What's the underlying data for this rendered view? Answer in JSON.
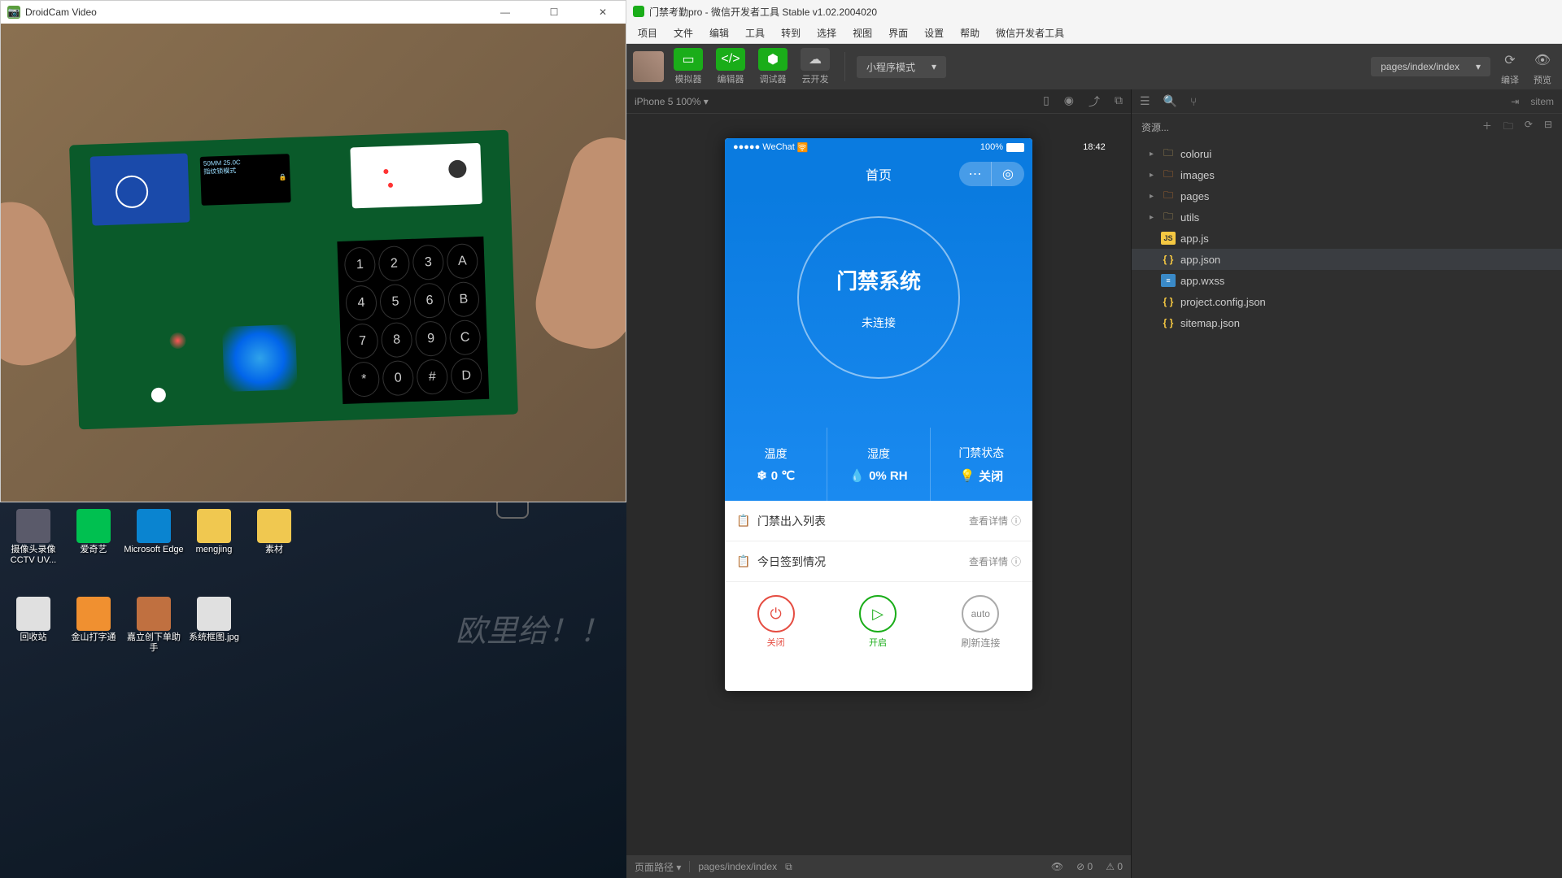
{
  "droidcam": {
    "title": "DroidCam Video",
    "oled_line1": "50MM  25.0C",
    "oled_line2": "指纹锁模式",
    "keys": [
      "1",
      "2",
      "3",
      "A",
      "4",
      "5",
      "6",
      "B",
      "7",
      "8",
      "9",
      "C",
      "*",
      "0",
      "#",
      "D"
    ]
  },
  "desktop": {
    "icons_row1": [
      {
        "label": "摄像头录像CCTV UV...",
        "color": "#5a5a6a"
      },
      {
        "label": "爱奇艺",
        "color": "#00c050"
      },
      {
        "label": "Microsoft Edge",
        "color": "#0a84d0"
      },
      {
        "label": "mengjing",
        "color": "#f0c850"
      },
      {
        "label": "素材",
        "color": "#f0c850"
      }
    ],
    "icons_row2": [
      {
        "label": "回收站",
        "color": "#e0e0e0"
      },
      {
        "label": "金山打字通",
        "color": "#f09030"
      },
      {
        "label": "嘉立创下单助手",
        "color": "#c07040"
      },
      {
        "label": "系统框图.jpg",
        "color": "#e0e0e0"
      }
    ],
    "watermark": "欧里给！！"
  },
  "devtools": {
    "title": "门禁考勤pro - 微信开发者工具 Stable v1.02.2004020",
    "menu": [
      "项目",
      "文件",
      "编辑",
      "工具",
      "转到",
      "选择",
      "视图",
      "界面",
      "设置",
      "帮助",
      "微信开发者工具"
    ],
    "toolbar": {
      "simulator": "模拟器",
      "editor": "编辑器",
      "debugger": "调试器",
      "cloud": "云开发",
      "mode": "小程序模式",
      "page_path": "pages/index/index",
      "compile": "编译",
      "preview": "预览"
    },
    "simulator": {
      "device": "iPhone 5 100% ▾"
    },
    "phone": {
      "carrier": "●●●●● WeChat",
      "time": "18:42",
      "battery": "100%",
      "nav_title": "首页",
      "hero_title": "门禁系统",
      "hero_status": "未连接",
      "stats": [
        {
          "label": "温度",
          "value": "0 ℃",
          "icon": "❄"
        },
        {
          "label": "湿度",
          "value": "0% RH",
          "icon": "💧"
        },
        {
          "label": "门禁状态",
          "value": "关闭",
          "icon": "💡"
        }
      ],
      "list": [
        {
          "label": "门禁出入列表",
          "action": "查看详情"
        },
        {
          "label": "今日签到情况",
          "action": "查看详情"
        }
      ],
      "actions": [
        {
          "label": "关闭",
          "icon": "⏻",
          "cls": "ac-red"
        },
        {
          "label": "开启",
          "icon": "▷",
          "cls": "ac-green"
        },
        {
          "label": "刷新连接",
          "icon": "auto",
          "cls": "ac-gray"
        }
      ]
    },
    "files": {
      "header": "资源...",
      "tree": [
        {
          "name": "colorui",
          "type": "folder",
          "indent": 1
        },
        {
          "name": "images",
          "type": "img-folder",
          "indent": 1
        },
        {
          "name": "pages",
          "type": "page-folder",
          "indent": 1
        },
        {
          "name": "utils",
          "type": "folder",
          "indent": 1
        },
        {
          "name": "app.js",
          "type": "js",
          "indent": 1
        },
        {
          "name": "app.json",
          "type": "json",
          "indent": 1,
          "selected": true
        },
        {
          "name": "app.wxss",
          "type": "wxss",
          "indent": 1
        },
        {
          "name": "project.config.json",
          "type": "json",
          "indent": 1
        },
        {
          "name": "sitemap.json",
          "type": "json",
          "indent": 1
        }
      ]
    },
    "footer": {
      "path_label": "页面路径 ▾",
      "path_value": "pages/index/index",
      "errors": "0",
      "warnings": "0"
    },
    "sitemap_hint": "sitem"
  }
}
